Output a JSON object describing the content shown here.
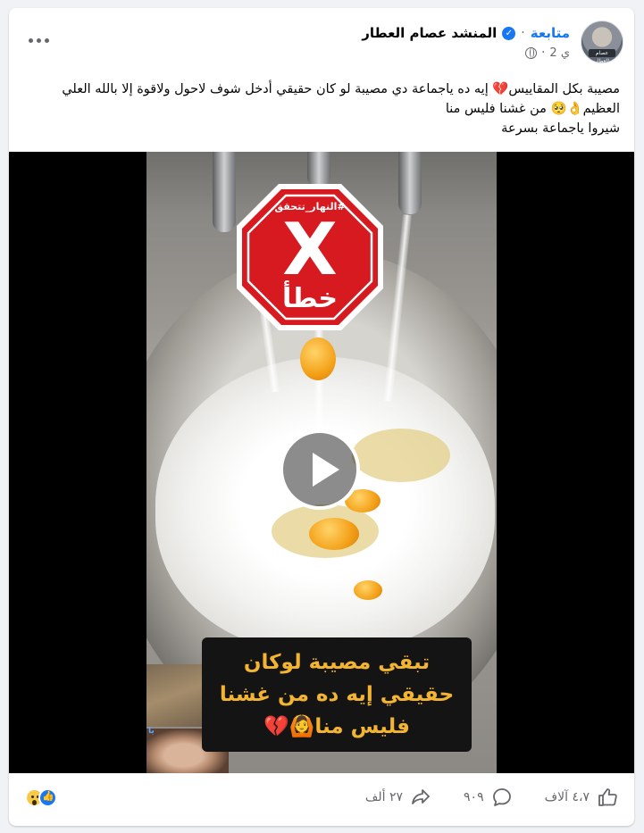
{
  "post": {
    "author": "المنشد عصام العطار",
    "follow_label": "متابعة",
    "time": "2 ي",
    "avatar_caption": "عصام العطار",
    "text_lines": [
      "مصيبة بكل المقاييس💔 إيه ده ياجماعة دي مصيبة لو كان حقيقي أدخل شوف لاحول ولاقوة إلا بالله العلي",
      "العظيم👌🥺 من غشنا فليس منا",
      "شيروا ياجماعة بسرعة"
    ]
  },
  "video": {
    "stamp_hashtag": "#النهار_تتحقق",
    "stamp_mark": "X",
    "stamp_word": "خطأ",
    "stamp_color": "#d71920",
    "caption_lines": [
      "تبقي مصيبة لوكان",
      "حقيقي إيه ده من غشنا",
      "فليس منا🙆💔"
    ],
    "caption_color": "#f3b531",
    "inset_label": "يا"
  },
  "actions": {
    "likes": "٤،٧ آلاف",
    "comments": "٩٠٩",
    "shares": "٢٧ ألف",
    "reaction_icons": [
      "wow-icon",
      "like-icon"
    ]
  },
  "colors": {
    "accent": "#1877f2",
    "muted": "#65676b"
  }
}
